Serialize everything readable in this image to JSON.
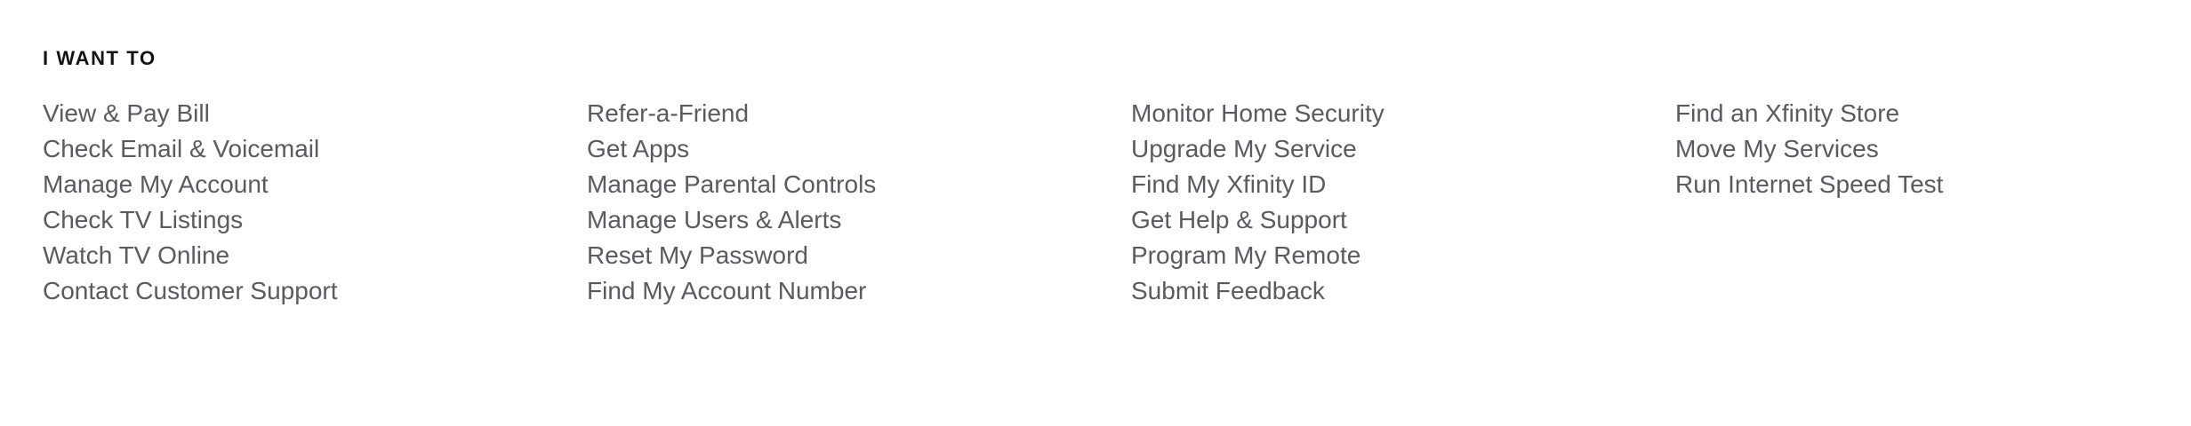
{
  "section": {
    "heading": "I WANT TO",
    "columns": [
      {
        "links": [
          "View & Pay Bill",
          "Check Email & Voicemail",
          "Manage My Account",
          "Check TV Listings",
          "Watch TV Online",
          "Contact Customer Support"
        ]
      },
      {
        "links": [
          "Refer-a-Friend",
          "Get Apps",
          "Manage Parental Controls",
          "Manage Users & Alerts",
          "Reset My Password",
          "Find My Account Number"
        ]
      },
      {
        "links": [
          "Monitor Home Security",
          "Upgrade My Service",
          "Find My Xfinity ID",
          "Get Help & Support",
          "Program My Remote",
          "Submit Feedback"
        ]
      },
      {
        "links": [
          "Find an Xfinity Store",
          "Move My Services",
          "Run Internet Speed Test"
        ]
      }
    ]
  }
}
